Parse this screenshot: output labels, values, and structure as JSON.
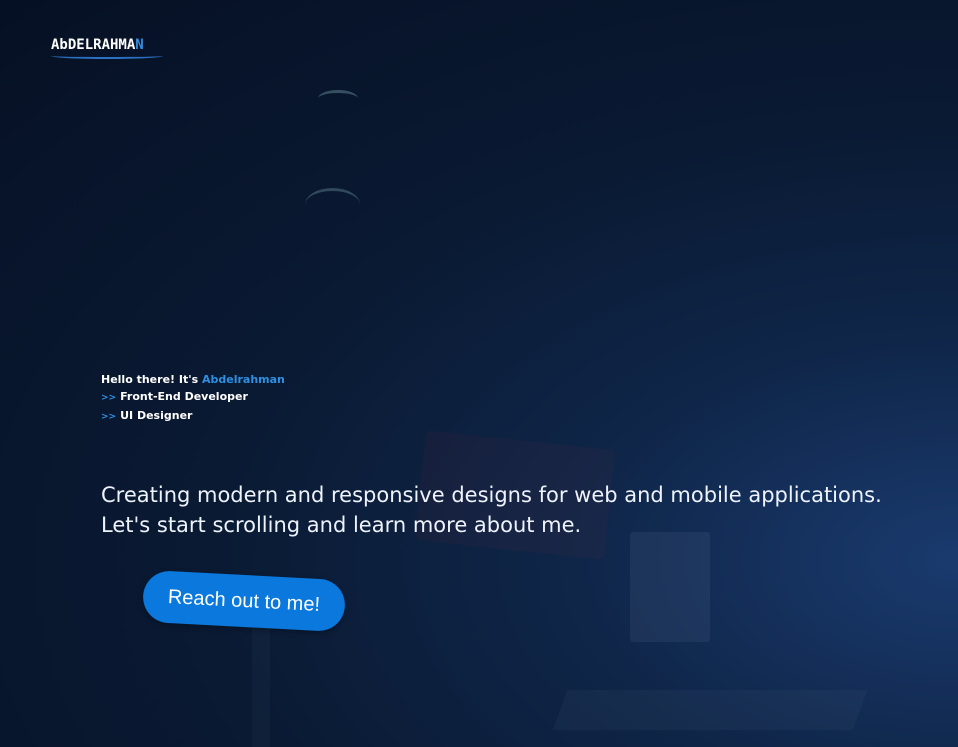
{
  "logo": {
    "letters_main": "AbDELRAHMA",
    "letters_accent": "N"
  },
  "intro": {
    "greeting": "Hello there! It's",
    "name": "Abdelrahman",
    "roles": [
      {
        "marker": ">>",
        "label": "Front-End Developer"
      },
      {
        "marker": ">>",
        "label": "UI Designer"
      }
    ]
  },
  "hero": {
    "tagline": "Creating modern and responsive designs for web and mobile applications. Let's start scrolling and learn more about me."
  },
  "cta": {
    "label": "Reach out to me!"
  },
  "colors": {
    "accent": "#2f8fe3",
    "button": "#0a78dc",
    "background": "#0a1a33"
  }
}
